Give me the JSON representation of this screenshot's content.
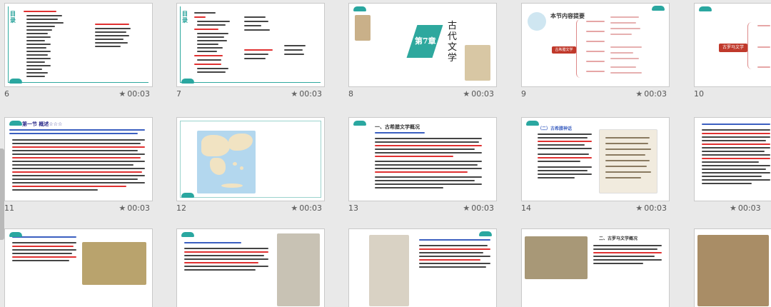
{
  "slides": [
    {
      "number": "6",
      "duration": "00:03",
      "heading": "目录"
    },
    {
      "number": "7",
      "duration": "00:03",
      "heading": "目录"
    },
    {
      "number": "8",
      "duration": "00:03",
      "title": "古代文学",
      "chapter": "第7章"
    },
    {
      "number": "9",
      "duration": "00:03",
      "title": "本节内容提要",
      "node": "古希腊文学"
    },
    {
      "number": "10",
      "duration": "",
      "node": "古罗马文学"
    },
    {
      "number": "11",
      "duration": "00:03",
      "title": "第一节  概述☆☆☆"
    },
    {
      "number": "12",
      "duration": "00:03"
    },
    {
      "number": "13",
      "duration": "00:03",
      "title": "一、古希腊文学概况"
    },
    {
      "number": "14",
      "duration": "00:03",
      "title": "（二）古希腊神话"
    },
    {
      "number": "",
      "duration": "00:03"
    },
    {
      "number": "",
      "duration": ""
    },
    {
      "number": "",
      "duration": ""
    },
    {
      "number": "",
      "duration": ""
    },
    {
      "number": "",
      "duration": ""
    },
    {
      "number": "",
      "duration": "",
      "title": "二、古罗马文学概况"
    },
    {
      "number": "",
      "duration": ""
    }
  ],
  "icons": {
    "timing": "star-icon"
  }
}
